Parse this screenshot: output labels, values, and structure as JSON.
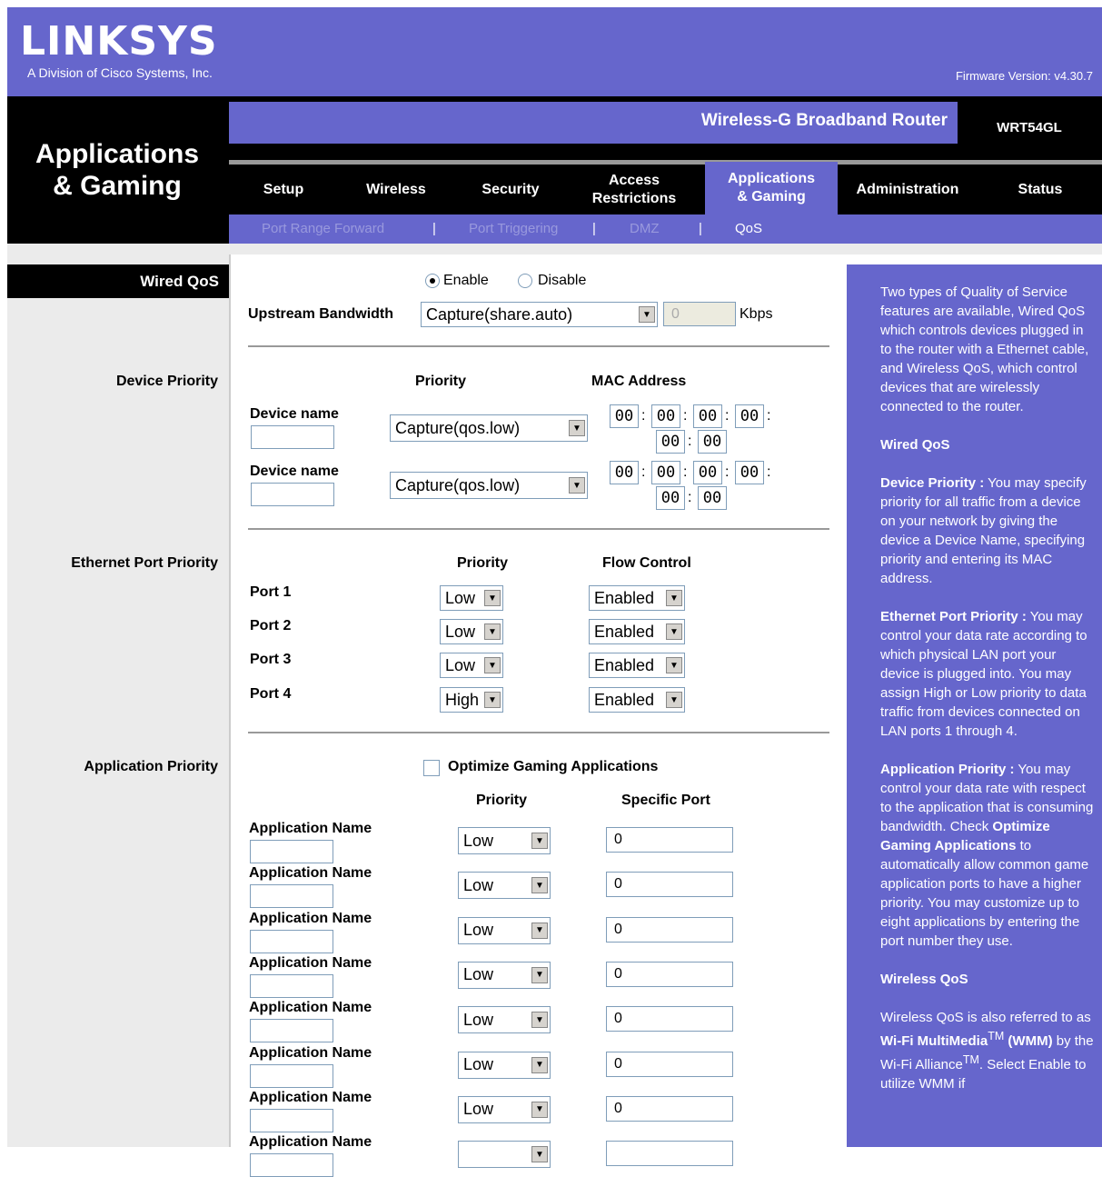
{
  "header": {
    "logo": "LINKSYS",
    "division": "A Division of Cisco Systems, Inc.",
    "firmware": "Firmware Version: v4.30.7",
    "section_title_line1": "Applications",
    "section_title_line2": "& Gaming",
    "product_name": "Wireless-G Broadband Router",
    "model": "WRT54GL"
  },
  "tabs": [
    {
      "label": "Setup"
    },
    {
      "label": "Wireless"
    },
    {
      "label": "Security"
    },
    {
      "label": "Access Restrictions"
    },
    {
      "label": "Applications & Gaming"
    },
    {
      "label": "Administration"
    },
    {
      "label": "Status"
    }
  ],
  "subtabs": [
    {
      "label": "Port Range Forward"
    },
    {
      "label": "Port Triggering"
    },
    {
      "label": "DMZ"
    },
    {
      "label": "QoS"
    }
  ],
  "left_labels": {
    "wired_qos": "Wired QoS",
    "device_priority": "Device Priority",
    "ethernet_port_priority": "Ethernet Port Priority",
    "application_priority": "Application Priority"
  },
  "wired": {
    "enable_label": "Enable",
    "disable_label": "Disable",
    "upstream_label": "Upstream Bandwidth",
    "upstream_value": "Capture(share.auto)",
    "upstream_kbps_value": "0",
    "kbps_label": "Kbps"
  },
  "device": {
    "priority_header": "Priority",
    "mac_header": "MAC Address",
    "rows": [
      {
        "label": "Device name",
        "priority": "Capture(qos.low)",
        "mac": [
          "00",
          "00",
          "00",
          "00",
          "00",
          "00"
        ]
      },
      {
        "label": "Device name",
        "priority": "Capture(qos.low)",
        "mac": [
          "00",
          "00",
          "00",
          "00",
          "00",
          "00"
        ]
      }
    ]
  },
  "ethernet": {
    "priority_header": "Priority",
    "flow_header": "Flow Control",
    "ports": [
      {
        "label": "Port 1",
        "priority": "Low",
        "flow": "Enabled"
      },
      {
        "label": "Port 2",
        "priority": "Low",
        "flow": "Enabled"
      },
      {
        "label": "Port 3",
        "priority": "Low",
        "flow": "Enabled"
      },
      {
        "label": "Port 4",
        "priority": "High",
        "flow": "Enabled"
      }
    ]
  },
  "application": {
    "optimize_label": "Optimize Gaming Applications",
    "priority_header": "Priority",
    "port_header": "Specific Port",
    "rows": [
      {
        "label": "Application Name",
        "priority": "Low",
        "port": "0"
      },
      {
        "label": "Application Name",
        "priority": "Low",
        "port": "0"
      },
      {
        "label": "Application Name",
        "priority": "Low",
        "port": "0"
      },
      {
        "label": "Application Name",
        "priority": "Low",
        "port": "0"
      },
      {
        "label": "Application Name",
        "priority": "Low",
        "port": "0"
      },
      {
        "label": "Application Name",
        "priority": "Low",
        "port": "0"
      },
      {
        "label": "Application Name",
        "priority": "Low",
        "port": "0"
      },
      {
        "label": "Application Name",
        "priority": "",
        "port": ""
      }
    ]
  },
  "help": {
    "intro": "Two types of Quality of Service features are available, Wired QoS which controls devices plugged in to the router with a Ethernet cable, and Wireless QoS, which control devices that are wirelessly connected to the router.",
    "wired_heading": "Wired QoS",
    "device_term": "Device Priority :",
    "device_text": " You may specify priority for all traffic from a device on your network by giving the device a Device Name, specifying priority and entering its MAC address.",
    "eth_term": "Ethernet Port Priority :",
    "eth_text": " You may control your data rate according to which physical LAN port your device is plugged into. You may assign High or Low priority to data traffic from devices connected on LAN ports 1 through 4.",
    "app_term": "Application Priority :",
    "app_text1": " You may control your data rate with respect to the application that is consuming bandwidth. Check ",
    "app_term2": "Optimize Gaming Applications",
    "app_text2": " to automatically allow common game application ports to have a higher priority. You may customize up to eight applications by entering the port number they use.",
    "wireless_heading": "Wireless QoS",
    "wmm_text1": "Wireless QoS is also referred to as ",
    "wmm_term": "Wi-Fi MultiMedia",
    "tm1": "TM",
    "wmm_term2": "(WMM)",
    "wmm_text2": " by the Wi-Fi Alliance",
    "tm2": "TM",
    "wmm_text3": ". Select Enable to utilize WMM if"
  }
}
